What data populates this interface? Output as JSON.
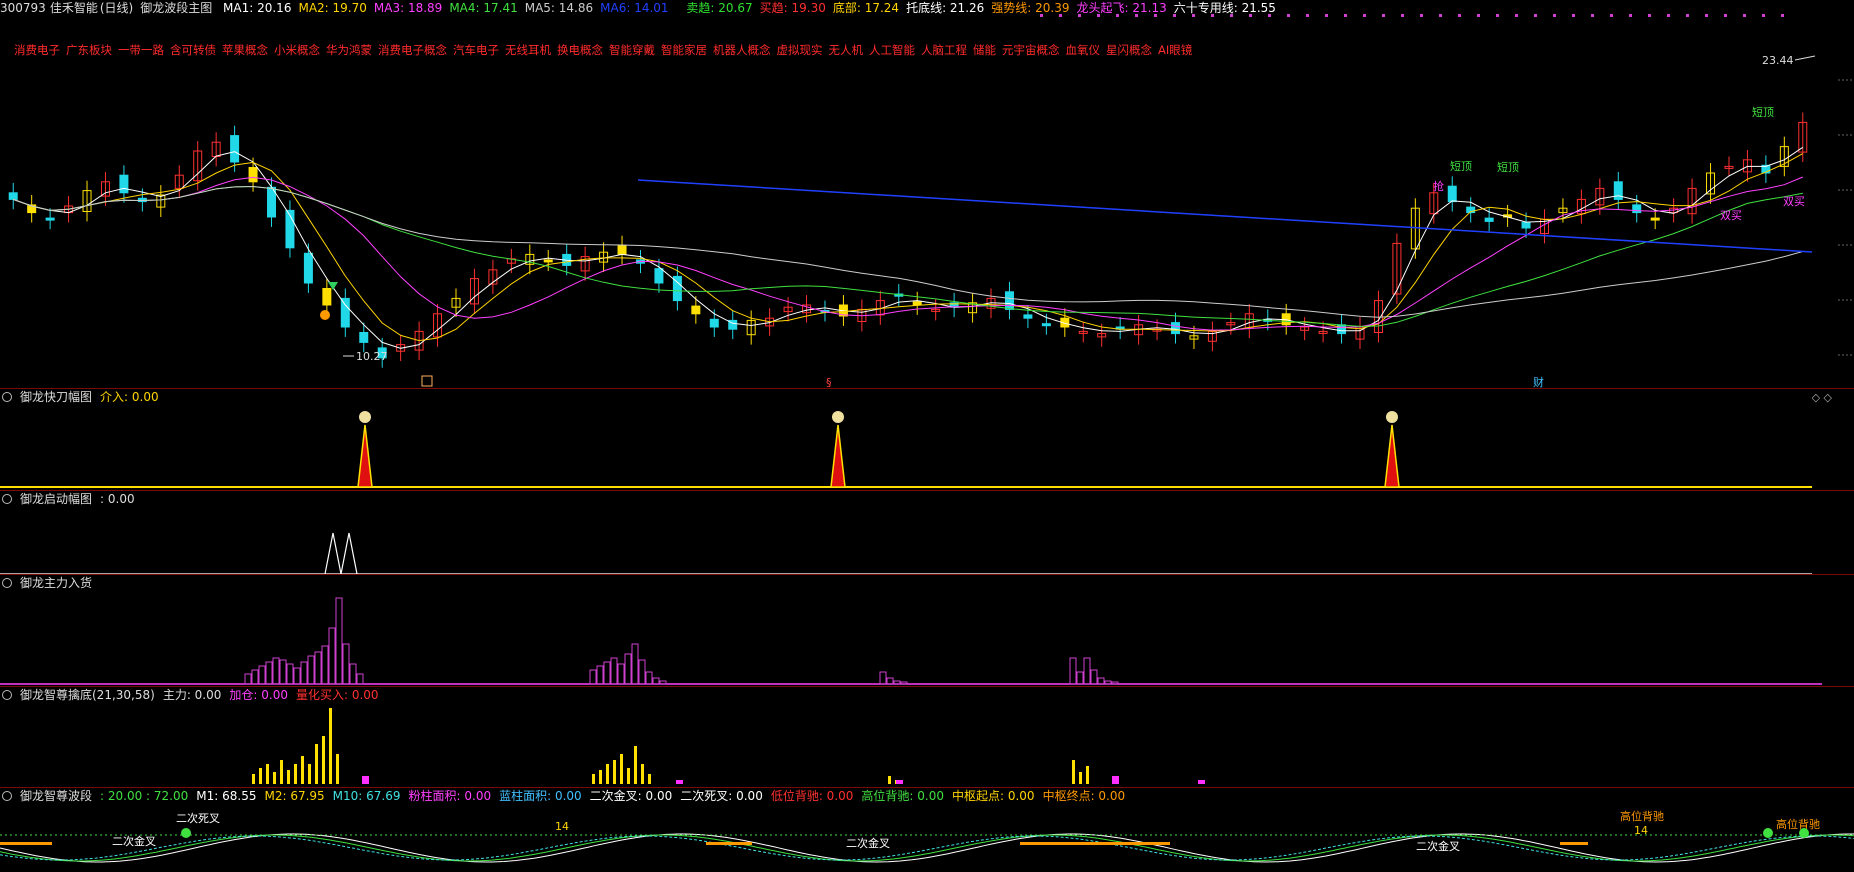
{
  "main_header": {
    "code": "300793",
    "name": "佳禾智能",
    "period": "(日线)",
    "indicator": "御龙波段主图",
    "ma": [
      {
        "label": "MA1:",
        "value": "20.16",
        "color": "#ffffff"
      },
      {
        "label": "MA2:",
        "value": "19.70",
        "color": "#ffd400"
      },
      {
        "label": "MA3:",
        "value": "18.89",
        "color": "#ff40ff"
      },
      {
        "label": "MA4:",
        "value": "17.41",
        "color": "#40e040"
      },
      {
        "label": "MA5:",
        "value": "14.86",
        "color": "#cccccc"
      },
      {
        "label": "MA6:",
        "value": "14.01",
        "color": "#2040ff"
      }
    ],
    "signals": [
      {
        "label": "卖趋:",
        "value": "20.67",
        "color": "#30e030"
      },
      {
        "label": "买趋:",
        "value": "19.30",
        "color": "#ff3030"
      },
      {
        "label": "底部:",
        "value": "17.24",
        "color": "#ffd400"
      },
      {
        "label": "托底线:",
        "value": "21.26",
        "color": "#ffffff"
      },
      {
        "label": "强势线:",
        "value": "20.39",
        "color": "#ff9900"
      },
      {
        "label": "龙头起飞:",
        "value": "21.13",
        "color": "#ff40ff"
      },
      {
        "label": "六十专用线:",
        "value": "21.55",
        "color": "#ffffff"
      }
    ]
  },
  "concepts": [
    "消费电子",
    "广东板块",
    "一带一路",
    "含可转债",
    "苹果概念",
    "小米概念",
    "华为鸿蒙",
    "消费电子概念",
    "汽车电子",
    "无线耳机",
    "换电概念",
    "智能穿戴",
    "智能家居",
    "机器人概念",
    "虚拟现实",
    "无人机",
    "人工智能",
    "人脑工程",
    "储能",
    "元宇宙概念",
    "血氧仪",
    "星闪概念",
    "AI眼镜"
  ],
  "price_labels": {
    "high": "23.44",
    "low": "10.27"
  },
  "chart_tags": [
    "短顶",
    "短顶",
    "短顶",
    "抢",
    "双买",
    "双买",
    "§",
    "财"
  ],
  "panels": {
    "p1": {
      "title": "御龙快刀幅图",
      "items": [
        {
          "label": "介入:",
          "value": "0.00",
          "color": "#ffd400"
        }
      ]
    },
    "p2": {
      "title": "御龙启动幅图",
      "items": [
        {
          "label": ":",
          "value": "0.00",
          "color": "#dddddd"
        }
      ]
    },
    "p3": {
      "title": "御龙主力入货",
      "items": []
    },
    "p4": {
      "title": "御龙智尊擒底(21,30,58)",
      "items": [
        {
          "label": "主力:",
          "value": "0.00",
          "color": "#dddddd"
        },
        {
          "label": "加仓:",
          "value": "0.00",
          "color": "#ff40ff"
        },
        {
          "label": "量化买入:",
          "value": "0.00",
          "color": "#ff3030"
        }
      ]
    },
    "p5": {
      "title": "御龙智尊波段",
      "items": [
        {
          "label": ":",
          "value": "20.00 : 72.00",
          "color": "#40e040"
        },
        {
          "label": "M1:",
          "value": "68.55",
          "color": "#ffffff"
        },
        {
          "label": "M2:",
          "value": "67.95",
          "color": "#ffd400"
        },
        {
          "label": "M10:",
          "value": "67.69",
          "color": "#40e0e0"
        },
        {
          "label": "粉柱面积:",
          "value": "0.00",
          "color": "#ff40ff"
        },
        {
          "label": "蓝柱面积:",
          "value": "0.00",
          "color": "#40c0ff"
        },
        {
          "label": "二次金叉:",
          "value": "0.00",
          "color": "#ffffff"
        },
        {
          "label": "二次死叉:",
          "value": "0.00",
          "color": "#ffffff"
        },
        {
          "label": "低位背驰:",
          "value": "0.00",
          "color": "#ff3030"
        },
        {
          "label": "高位背驰:",
          "value": "0.00",
          "color": "#40e040"
        },
        {
          "label": "中枢起点:",
          "value": "0.00",
          "color": "#ffd400"
        },
        {
          "label": "中枢终点:",
          "value": "0.00",
          "color": "#ff9900"
        }
      ]
    }
  },
  "osc_tags": [
    "二次死叉",
    "二次金叉",
    "二次金叉",
    "二次金叉",
    "高位背驰",
    "高位背驰",
    "14",
    "14"
  ],
  "chart_data": {
    "type": "candlestick",
    "close_series": [
      17.8,
      17.2,
      16.9,
      17.5,
      18.2,
      18.6,
      18.1,
      17.7,
      18.0,
      18.9,
      20.0,
      20.4,
      19.5,
      18.6,
      17.0,
      15.6,
      14.0,
      13.0,
      12.0,
      11.3,
      10.6,
      11.2,
      11.8,
      12.6,
      13.3,
      14.2,
      14.6,
      15.1,
      15.3,
      15.0,
      14.8,
      15.2,
      15.4,
      15.3,
      14.9,
      14.0,
      13.2,
      12.6,
      12.0,
      11.9,
      12.3,
      12.4,
      12.9,
      13.0,
      12.7,
      12.5,
      12.8,
      13.2,
      13.4,
      13.0,
      12.8,
      12.9,
      13.1,
      13.3,
      12.8,
      12.4,
      12.1,
      12.0,
      11.8,
      11.7,
      11.9,
      12.1,
      11.9,
      11.7,
      11.6,
      11.8,
      12.2,
      12.6,
      12.3,
      12.1,
      12.0,
      11.8,
      11.7,
      12.0,
      13.2,
      15.8,
      17.4,
      18.1,
      17.7,
      17.2,
      16.8,
      17.0,
      16.5,
      16.9,
      17.4,
      17.8,
      18.3,
      17.8,
      17.2,
      16.9,
      17.4,
      18.3,
      19.0,
      19.3,
      19.6,
      19.0,
      20.2,
      21.3
    ],
    "ylim": [
      9.5,
      24.5
    ],
    "high_label": 23.44,
    "low_label": 10.27
  }
}
